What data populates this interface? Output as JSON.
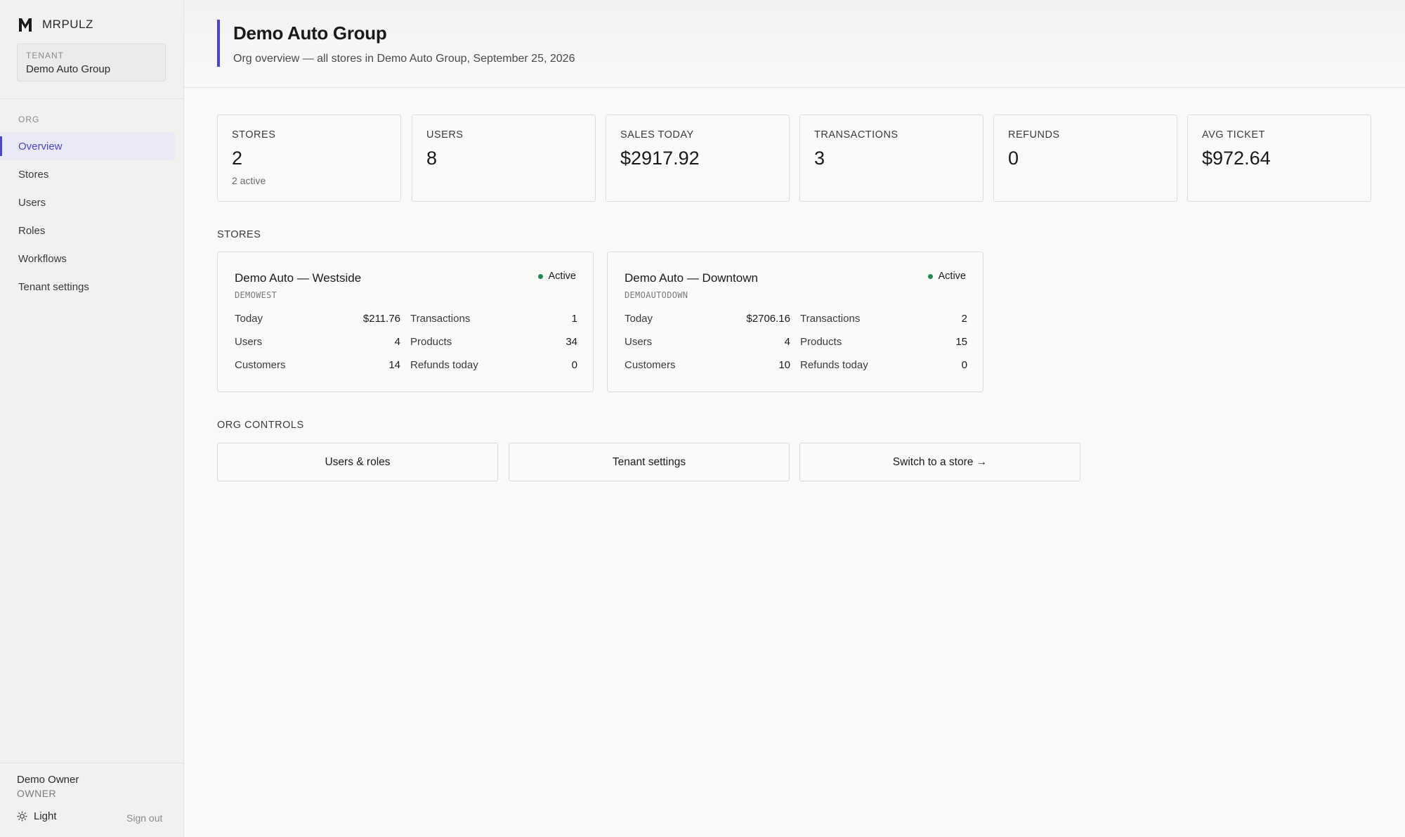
{
  "app": {
    "brand": "MRPULZ"
  },
  "sidebar": {
    "tenant_label": "TENANT",
    "tenant_name": "Demo Auto Group",
    "section_label": "ORG",
    "items": [
      {
        "label": "Overview",
        "active": true
      },
      {
        "label": "Stores"
      },
      {
        "label": "Users"
      },
      {
        "label": "Roles"
      },
      {
        "label": "Workflows"
      },
      {
        "label": "Tenant settings"
      }
    ],
    "user": {
      "name": "Demo Owner",
      "role": "OWNER"
    },
    "theme_label": "Light",
    "signout_label": "Sign out"
  },
  "header": {
    "title": "Demo Auto Group",
    "subtitle": "Org overview — all stores in Demo Auto Group, September 25, 2026"
  },
  "stats": [
    {
      "label": "STORES",
      "value": "2",
      "sub": "2 active"
    },
    {
      "label": "USERS",
      "value": "8"
    },
    {
      "label": "SALES TODAY",
      "value": "$2917.92"
    },
    {
      "label": "TRANSACTIONS",
      "value": "3"
    },
    {
      "label": "REFUNDS",
      "value": "0"
    },
    {
      "label": "AVG TICKET",
      "value": "$972.64"
    }
  ],
  "stores_label": "STORES",
  "stores": [
    {
      "name": "Demo Auto — Westside",
      "code": "DEMOWEST",
      "status": "Active",
      "rows": [
        {
          "l_label": "Today",
          "l_value": "$211.76",
          "r_label": "Transactions",
          "r_value": "1"
        },
        {
          "l_label": "Users",
          "l_value": "4",
          "r_label": "Products",
          "r_value": "34"
        },
        {
          "l_label": "Customers",
          "l_value": "14",
          "r_label": "Refunds today",
          "r_value": "0"
        }
      ]
    },
    {
      "name": "Demo Auto — Downtown",
      "code": "DEMOAUTODOWN",
      "status": "Active",
      "rows": [
        {
          "l_label": "Today",
          "l_value": "$2706.16",
          "r_label": "Transactions",
          "r_value": "2"
        },
        {
          "l_label": "Users",
          "l_value": "4",
          "r_label": "Products",
          "r_value": "15"
        },
        {
          "l_label": "Customers",
          "l_value": "10",
          "r_label": "Refunds today",
          "r_value": "0"
        }
      ]
    }
  ],
  "controls_label": "ORG CONTROLS",
  "controls": [
    {
      "label": "Users & roles"
    },
    {
      "label": "Tenant settings"
    },
    {
      "label": "Switch to a store →"
    }
  ],
  "colors": {
    "accent": "#4b45cf",
    "active_status": "#1f8a4c",
    "background": "#f9f9f8",
    "sidebar": "#f1f1f0"
  }
}
